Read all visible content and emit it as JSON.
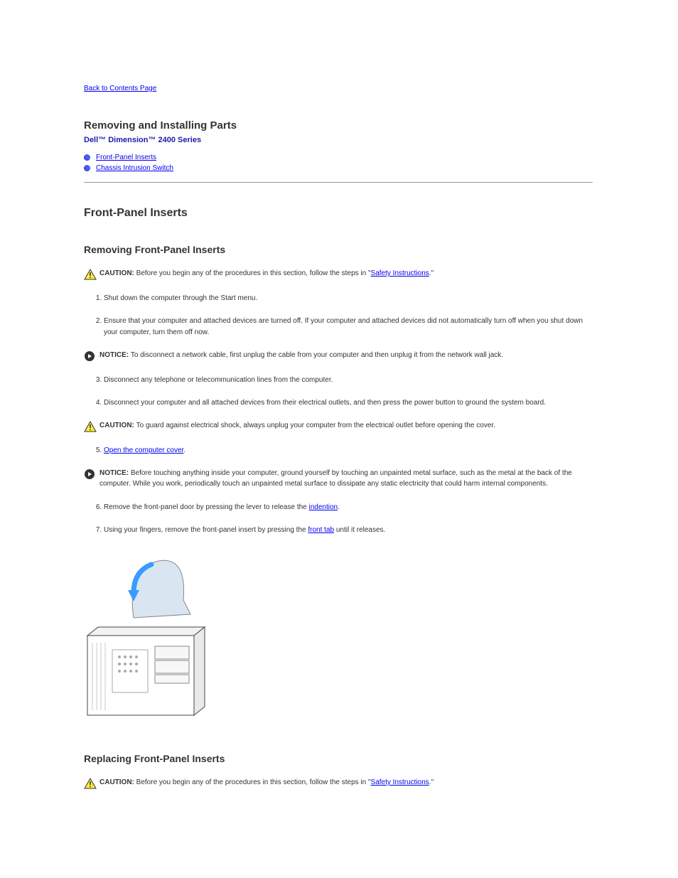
{
  "nav": {
    "back": "Back to Contents Page"
  },
  "title": "Removing and Installing Parts",
  "subtitle": "Dell™ Dimension™ 2400 Series",
  "toc": [
    {
      "label": "Front-Panel Inserts"
    },
    {
      "label": "Chassis Intrusion Switch"
    }
  ],
  "sections": {
    "front_panel": {
      "h2": "Front-Panel Inserts",
      "h3_remove": "Removing Front-Panel Inserts",
      "caution1_label": "CAUTION: ",
      "caution1": "Before you begin any of the procedures in this section, follow the steps in \"",
      "caution1_link": "Safety Instructions",
      "caution1_after": ".\"",
      "steps_a": [
        "Shut down the computer through the Start menu.",
        "Ensure that your computer and attached devices are turned off. If your computer and attached devices did not automatically turn off when you shut down your computer, turn them off now."
      ],
      "notice1_label": "NOTICE: ",
      "notice1": "To disconnect a network cable, first unplug the cable from your computer and then unplug it from the network wall jack.",
      "steps_b": [
        "Disconnect any telephone or telecommunication lines from the computer.",
        "Disconnect your computer and all attached devices from their electrical outlets, and then press the power button to ground the system board."
      ],
      "caution2_label": "CAUTION: ",
      "caution2": "To guard against electrical shock, always unplug your computer from the electrical outlet before opening the cover.",
      "steps_c_5": "",
      "steps_c_5_link": "Open the computer cover",
      "steps_c_5_after": ".",
      "notice2_label": "NOTICE: ",
      "notice2": "Before touching anything inside your computer, ground yourself by touching an unpainted metal surface, such as the metal at the back of the computer. While you work, periodically touch an unpainted metal surface to dissipate any static electricity that could harm internal components.",
      "steps_d": [
        {
          "text": "Remove the front-panel door by pressing the lever to release the ",
          "link": "indention",
          "after": "."
        },
        {
          "text": "Using your fingers, remove the front-panel insert by pressing the ",
          "link": "front tab",
          "after": " until it releases."
        }
      ],
      "h3_replace": "Replacing Front-Panel Inserts",
      "caution3_label": "CAUTION: ",
      "caution3": "Before you begin any of the procedures in this section, follow the steps in \"",
      "caution3_link": "Safety Instructions",
      "caution3_after": ".\""
    }
  }
}
